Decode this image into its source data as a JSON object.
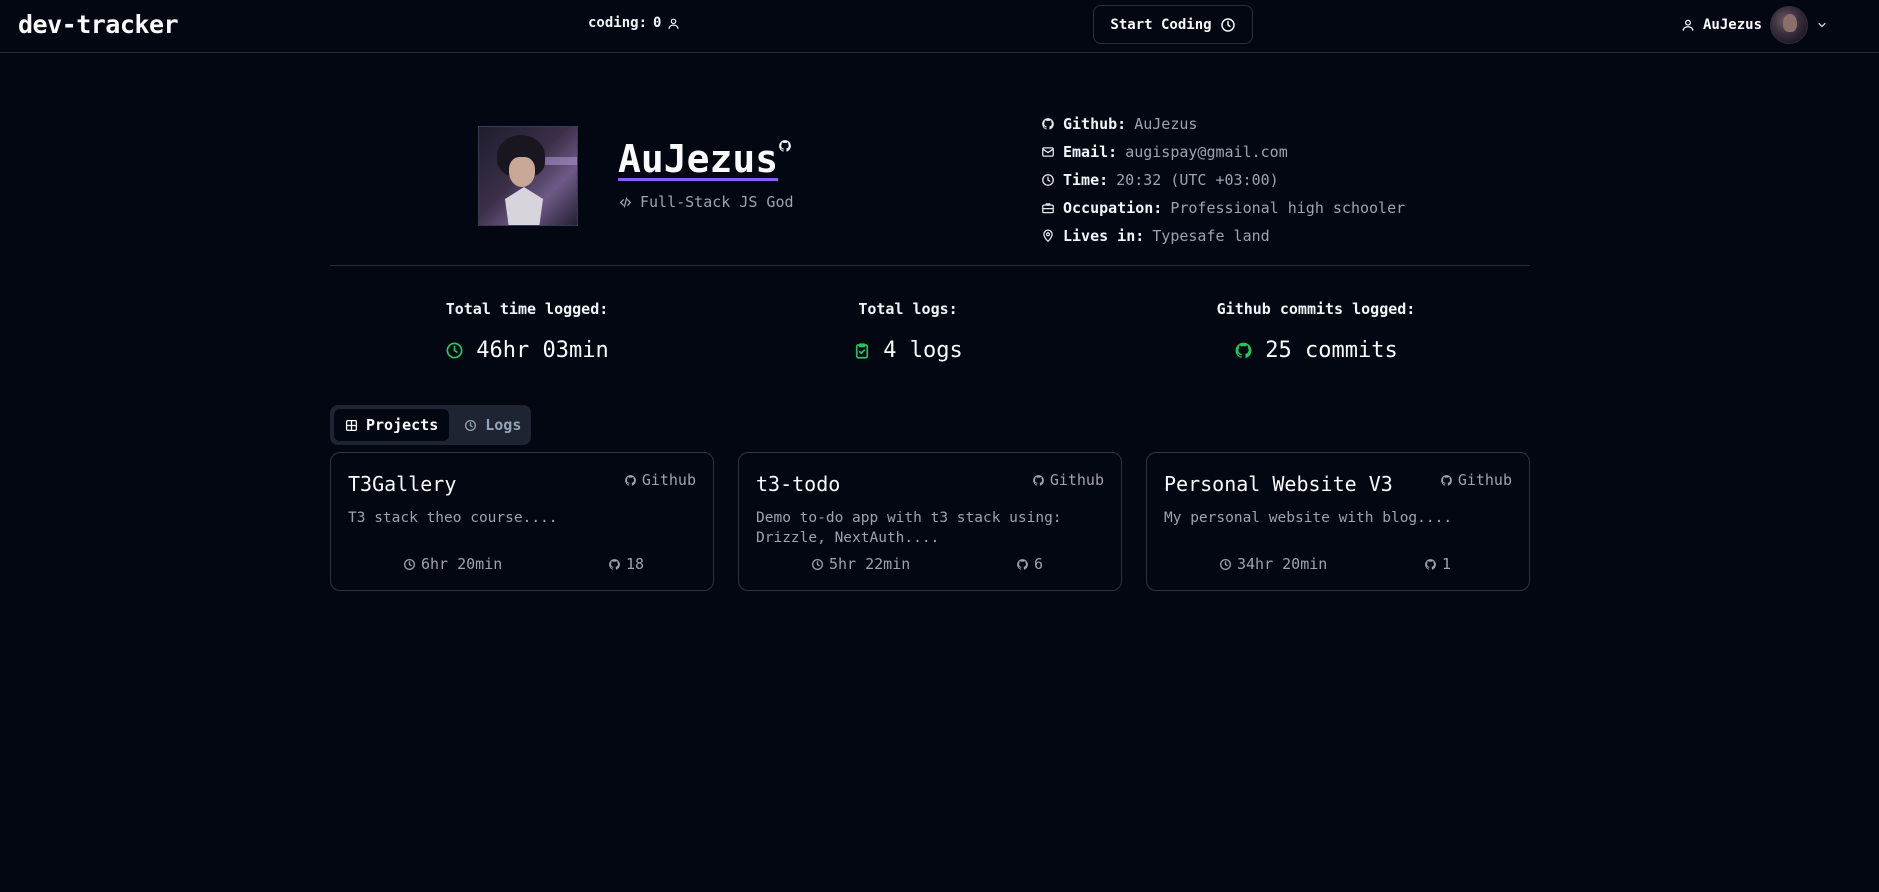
{
  "nav": {
    "brand": "dev-tracker",
    "coding_label": "coding:",
    "coding_count": "0",
    "start_button": "Start Coding",
    "username": "AuJezus"
  },
  "profile": {
    "name": "AuJezus",
    "role": "Full-Stack JS God",
    "info": [
      {
        "key": "Github:",
        "value": "AuJezus",
        "icon": "github-icon"
      },
      {
        "key": "Email:",
        "value": "augispay@gmail.com",
        "icon": "mail-icon"
      },
      {
        "key": "Time:",
        "value": "20:32 (UTC +03:00)",
        "icon": "clock-icon"
      },
      {
        "key": "Occupation:",
        "value": "Professional high schooler",
        "icon": "briefcase-icon"
      },
      {
        "key": "Lives in:",
        "value": "Typesafe land",
        "icon": "map-pin-icon"
      }
    ]
  },
  "stats": [
    {
      "label": "Total time logged:",
      "value": "46hr 03min",
      "icon": "clock-icon"
    },
    {
      "label": "Total logs:",
      "value": "4 logs",
      "icon": "clipboard-check-icon"
    },
    {
      "label": "Github commits logged:",
      "value": "25 commits",
      "icon": "github-icon"
    }
  ],
  "tabs": [
    {
      "label": "Projects",
      "active": true,
      "icon": "grid-icon"
    },
    {
      "label": "Logs",
      "active": false,
      "icon": "clock-icon"
    }
  ],
  "projects": [
    {
      "title": "T3Gallery",
      "link": "Github",
      "description": "T3 stack theo course....",
      "time": "6hr 20min",
      "commits": "18"
    },
    {
      "title": "t3-todo",
      "link": "Github",
      "description": "Demo to-do app with t3 stack using: Drizzle, NextAuth....",
      "time": "5hr 22min",
      "commits": "6"
    },
    {
      "title": "Personal Website V3",
      "link": "Github",
      "description": "My personal website with blog....",
      "time": "34hr 20min",
      "commits": "1"
    }
  ],
  "colors": {
    "background": "#030712",
    "accent_green": "#22c55e",
    "underline_purple": "#8b5cf6",
    "muted_text": "#9ca3af"
  }
}
